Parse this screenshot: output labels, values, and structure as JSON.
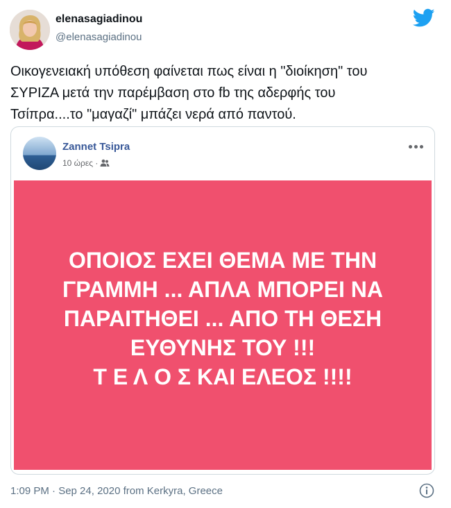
{
  "user": {
    "display_name": "elenasagiadinou",
    "handle": "@elenasagiadinou"
  },
  "brand": {
    "icon": "twitter-bird-icon",
    "color": "#1da1f2"
  },
  "tweet": {
    "text": "Οικογενειακή υπόθεση φαίνεται πως είναι η \"διοίκηση\" του\nΣΥΡΙΖΑ μετά την παρέμβαση στο fb της αδερφής του\nΤσίπρα....το \"μαγαζί\" μπάζει νερά από παντού."
  },
  "embedded_post": {
    "author": "Zannet Tsipra",
    "time_ago": "10 ώρες ·",
    "audience_icon": "friends-icon",
    "more_icon": "more-options-icon",
    "background_color": "#f0506e",
    "post_text": "ΟΠΟΙΟΣ ΕΧΕΙ ΘΕΜΑ ΜΕ ΤΗΝ\nΓΡΑΜΜΗ ... ΑΠΛΑ ΜΠΟΡΕΙ ΝΑ\nΠΑΡΑΙΤΗΘΕΙ ... ΑΠΟ ΤΗ ΘΕΣΗ\nΕΥΘΥΝΗΣ ΤΟΥ !!!\nΤ Ε Λ Ο Σ ΚΑΙ ΕΛΕΟΣ !!!!"
  },
  "footer": {
    "timestamp": "1:09 PM · Sep 24, 2020 from Kerkyra, Greece",
    "info_icon": "info-icon"
  }
}
